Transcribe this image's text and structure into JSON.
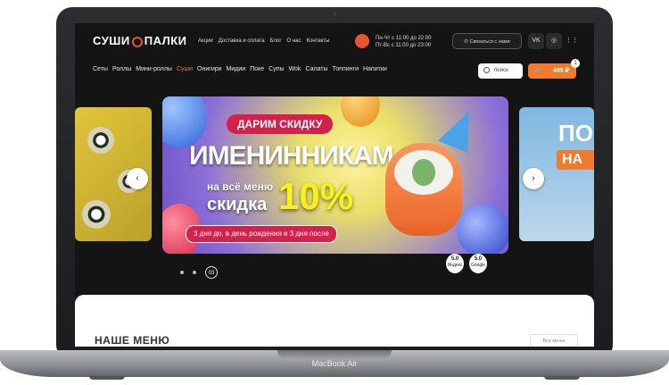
{
  "device": {
    "model_label": "MacBook Air"
  },
  "header": {
    "logo_left": "СУШИ",
    "logo_right": "ПАЛКИ",
    "top_links": [
      "Акции",
      "Доставка и оплата",
      "Блог",
      "О нас",
      "Контакты"
    ],
    "hours_line1": "Пн-Чт с 11:00 до 22:00",
    "hours_line2": "Пт-Вс с 11:00 до 23:00",
    "call_button": "Связаться с нами",
    "social_vk": "VK"
  },
  "menu_nav": {
    "items": [
      "Сеты",
      "Роллы",
      "Мини-роллы",
      "Суши",
      "Онигири",
      "Мидии",
      "Поке",
      "Супы",
      "Wok",
      "Салаты",
      "Топпинги",
      "Напитки"
    ],
    "active_index": 3
  },
  "search": {
    "placeholder": "поиск"
  },
  "cart": {
    "total": "495 ₽",
    "count": "1"
  },
  "banner": {
    "tag": "ДАРИМ СКИДКУ",
    "headline": "ИМЕНИННИКАМ",
    "line1": "на всё меню",
    "line2": "скидка",
    "discount": "10%",
    "footnote": "3 дня до, в день рождения и 3 дня после"
  },
  "side_banner_right": {
    "text": "ПО",
    "tag": "НА"
  },
  "slider": {
    "current_slide": "03"
  },
  "ratings": [
    {
      "score": "5.0",
      "source": "Яндекс"
    },
    {
      "score": "5.0",
      "source": "Google"
    }
  ],
  "menu_section": {
    "title": "НАШЕ МЕНЮ",
    "all_button": "Все меню"
  },
  "colors": {
    "accent": "#f07a2e",
    "background": "#141414",
    "banner_tag": "#d6204c",
    "discount": "#f6f21a"
  }
}
